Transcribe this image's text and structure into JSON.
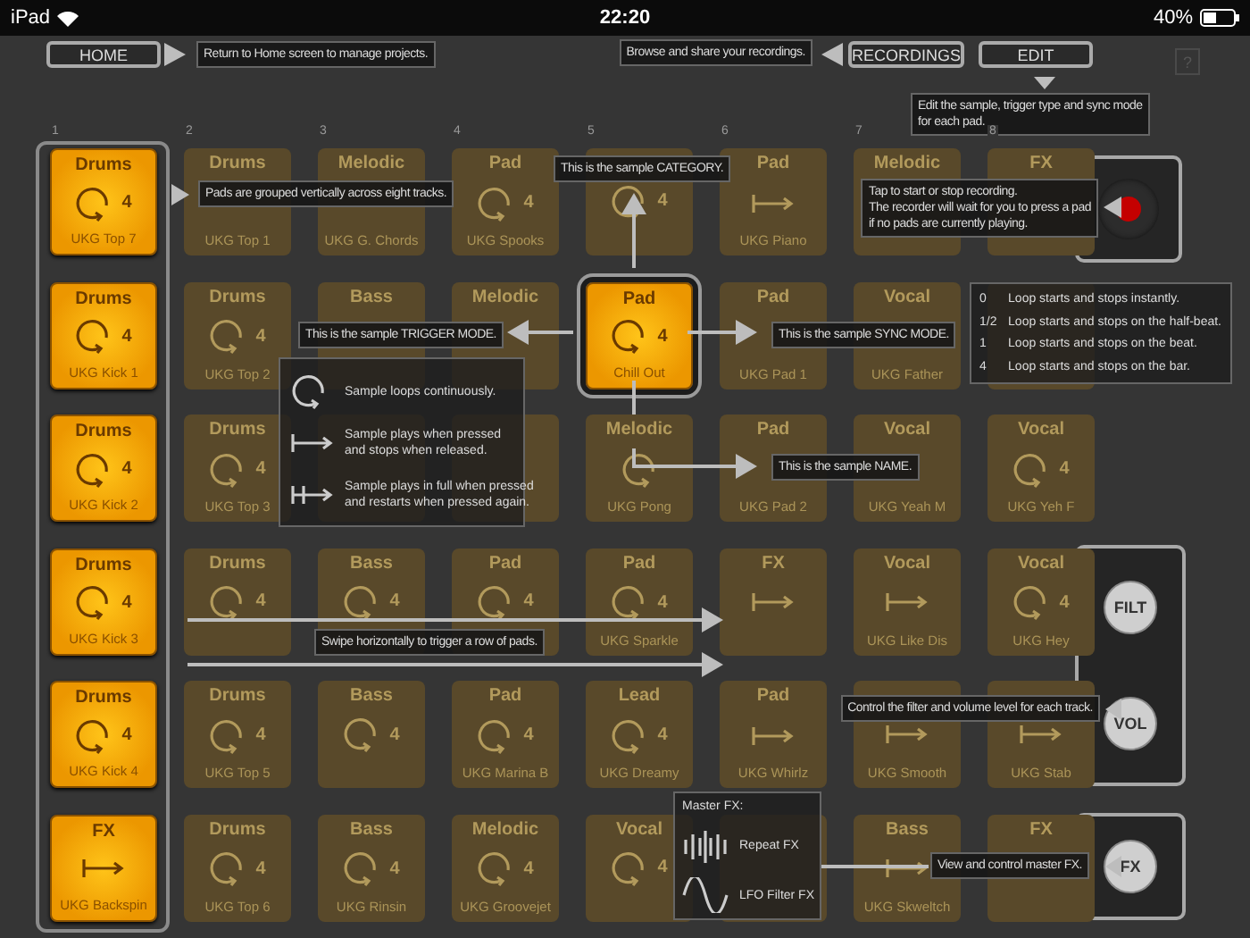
{
  "status_bar": {
    "carrier": "iPad",
    "time": "22:20",
    "battery": "40%"
  },
  "toolbar": {
    "home": "HOME",
    "recordings": "RECORDINGS",
    "edit": "EDIT",
    "help": "?"
  },
  "column_numbers": [
    "1",
    "2",
    "3",
    "4",
    "5",
    "6",
    "7",
    "8"
  ],
  "pad_rows": [
    {
      "pads": [
        {
          "category": "Drums",
          "trigger": {
            "kind": "loop"
          },
          "sync": "4",
          "name": "UKG Top 7",
          "lit": true,
          "selected": false
        },
        {
          "category": "Drums",
          "name": "UKG Top 1",
          "lit": false,
          "selected": false
        },
        {
          "category": "Melodic",
          "name": "UKG G. Chords",
          "lit": false,
          "selected": false
        },
        {
          "category": "Pad",
          "trigger": {
            "kind": "loop"
          },
          "sync": "4",
          "name": "UKG Spooks",
          "lit": false,
          "selected": false
        },
        {
          "trigger": {
            "kind": "loop"
          },
          "sync": "4",
          "lit": false,
          "selected": false
        },
        {
          "category": "Pad",
          "trigger": {
            "kind": "hold"
          },
          "name": "UKG Piano",
          "lit": false,
          "selected": false
        },
        {
          "category": "Melodic",
          "lit": false,
          "selected": false
        },
        {
          "category": "FX",
          "lit": false,
          "selected": false
        }
      ]
    },
    {
      "pads": [
        {
          "category": "Drums",
          "trigger": {
            "kind": "loop"
          },
          "sync": "4",
          "name": "UKG Kick 1",
          "lit": true,
          "selected": false
        },
        {
          "category": "Drums",
          "trigger": {
            "kind": "loop"
          },
          "sync": "4",
          "name": "UKG Top 2",
          "lit": false,
          "selected": false
        },
        {
          "category": "Bass",
          "lit": false,
          "selected": false
        },
        {
          "category": "Melodic",
          "lit": false,
          "selected": false
        },
        {
          "category": "Pad",
          "trigger": {
            "kind": "loop"
          },
          "sync": "4",
          "name": "Chill Out",
          "lit": true,
          "selected": true
        },
        {
          "category": "Pad",
          "name": "UKG Pad 1",
          "lit": false,
          "selected": false
        },
        {
          "category": "Vocal",
          "name": "UKG Father",
          "lit": false,
          "selected": false
        },
        {
          "lit": false,
          "selected": false
        }
      ]
    },
    {
      "pads": [
        {
          "category": "Drums",
          "trigger": {
            "kind": "loop"
          },
          "sync": "4",
          "name": "UKG Kick 2",
          "lit": true,
          "selected": false
        },
        {
          "category": "Drums",
          "trigger": {
            "kind": "loop"
          },
          "sync": "4",
          "name": "UKG Top 3",
          "lit": false,
          "selected": false
        },
        {
          "lit": false
        },
        {
          "lit": false,
          "selected": false
        },
        {
          "category": "Melodic",
          "trigger": {
            "kind": "loop"
          },
          "name": "UKG Pong",
          "lit": false,
          "selected": false
        },
        {
          "category": "Pad",
          "name": "UKG Pad 2",
          "lit": false,
          "selected": false
        },
        {
          "category": "Vocal",
          "name": "UKG Yeah M",
          "lit": false,
          "selected": false
        },
        {
          "category": "Vocal",
          "trigger": {
            "kind": "loop"
          },
          "sync": "4",
          "name": "UKG Yeh F",
          "lit": false,
          "selected": false
        }
      ]
    },
    {
      "pads": [
        {
          "category": "Drums",
          "trigger": {
            "kind": "loop"
          },
          "sync": "4",
          "name": "UKG Kick 3",
          "lit": true,
          "selected": false
        },
        {
          "category": "Drums",
          "trigger": {
            "kind": "loop"
          },
          "sync": "4",
          "lit": false,
          "selected": false
        },
        {
          "category": "Bass",
          "trigger": {
            "kind": "loop"
          },
          "sync": "4",
          "lit": false,
          "selected": false
        },
        {
          "category": "Pad",
          "trigger": {
            "kind": "loop"
          },
          "sync": "4",
          "lit": false,
          "selected": false
        },
        {
          "category": "Pad",
          "trigger": {
            "kind": "loop"
          },
          "sync": "4",
          "name": "UKG Sparkle",
          "lit": false,
          "selected": false
        },
        {
          "category": "FX",
          "trigger": {
            "kind": "hold"
          },
          "lit": false,
          "selected": false
        },
        {
          "category": "Vocal",
          "trigger": {
            "kind": "hold"
          },
          "name": "UKG Like Dis",
          "lit": false,
          "selected": false
        },
        {
          "category": "Vocal",
          "trigger": {
            "kind": "loop"
          },
          "sync": "4",
          "name": "UKG Hey",
          "lit": false,
          "selected": false
        }
      ]
    },
    {
      "pads": [
        {
          "category": "Drums",
          "trigger": {
            "kind": "loop"
          },
          "sync": "4",
          "name": "UKG Kick 4",
          "lit": true,
          "selected": false
        },
        {
          "category": "Drums",
          "trigger": {
            "kind": "loop"
          },
          "sync": "4",
          "name": "UKG Top 5",
          "lit": false,
          "selected": false
        },
        {
          "category": "Bass",
          "trigger": {
            "kind": "loop"
          },
          "sync": "4",
          "lit": false,
          "selected": false
        },
        {
          "category": "Pad",
          "trigger": {
            "kind": "loop"
          },
          "sync": "4",
          "name": "UKG Marina B",
          "lit": false,
          "selected": false
        },
        {
          "category": "Lead",
          "trigger": {
            "kind": "loop"
          },
          "sync": "4",
          "name": "UKG Dreamy",
          "lit": false,
          "selected": false
        },
        {
          "category": "Pad",
          "trigger": {
            "kind": "hold"
          },
          "name": "UKG Whirlz",
          "lit": false,
          "selected": false
        },
        {
          "trigger": {
            "kind": "hold"
          },
          "name": "UKG Smooth",
          "lit": false,
          "selected": false
        },
        {
          "trigger": {
            "kind": "hold"
          },
          "name": "UKG Stab",
          "lit": false,
          "selected": false
        }
      ]
    },
    {
      "pads": [
        {
          "category": "FX",
          "trigger": {
            "kind": "hold"
          },
          "name": "UKG Backspin",
          "lit": true,
          "selected": false
        },
        {
          "category": "Drums",
          "trigger": {
            "kind": "loop"
          },
          "sync": "4",
          "name": "UKG Top 6",
          "lit": false,
          "selected": false
        },
        {
          "category": "Bass",
          "trigger": {
            "kind": "loop"
          },
          "sync": "4",
          "name": "UKG Rinsin",
          "lit": false,
          "selected": false
        },
        {
          "category": "Melodic",
          "trigger": {
            "kind": "loop"
          },
          "sync": "4",
          "name": "UKG Groovejet",
          "lit": false,
          "selected": false
        },
        {
          "category": "Vocal",
          "trigger": {
            "kind": "loop"
          },
          "sync": "4",
          "lit": false,
          "selected": false
        },
        {
          "lit": false,
          "selected": false
        },
        {
          "category": "Bass",
          "trigger": {
            "kind": "hold"
          },
          "name": "UKG Skweltch",
          "lit": false,
          "selected": false
        },
        {
          "category": "FX",
          "lit": false,
          "selected": false
        }
      ]
    }
  ],
  "track_controls": {
    "filter": "FILT",
    "volume": "VOL",
    "fx": "FX"
  },
  "help": {
    "home": "Return to Home screen to manage projects.",
    "recordings": "Browse and share your recordings.",
    "edit": "Edit the sample, trigger type and sync mode\nfor each pad.",
    "tracks": "Pads are grouped vertically across eight tracks.",
    "category": "This is the sample CATEGORY.",
    "trigger_mode": "This is the sample TRIGGER MODE.",
    "sync_mode": "This is the sample SYNC MODE.",
    "name": "This is the sample NAME.",
    "record": "Tap to start or stop recording.\nThe recorder will wait for you to press a pad\nif no pads are currently playing.",
    "swipe": "Swipe horizontally to trigger a row of pads.",
    "track_controls": "Control the filter and volume level for each track.",
    "master_fx": "View and control master FX."
  },
  "trigger_legend": [
    {
      "kind": "loop",
      "text": "Sample loops continuously."
    },
    {
      "kind": "hold",
      "text": "Sample plays when pressed\nand stops when released."
    },
    {
      "kind": "full",
      "text": "Sample plays in full when pressed\nand restarts when pressed again."
    }
  ],
  "sync_legend": [
    {
      "value": "0",
      "text": "Loop starts and stops instantly."
    },
    {
      "value": "1/2",
      "text": "Loop starts and stops on the half-beat."
    },
    {
      "value": "1",
      "text": "Loop starts and stops on the beat."
    },
    {
      "value": "4",
      "text": "Loop starts and stops on the bar."
    }
  ],
  "master_fx_legend": {
    "title": "Master FX:",
    "items": [
      {
        "kind": "repeat",
        "text": "Repeat FX"
      },
      {
        "kind": "lfo",
        "text": "LFO Filter FX"
      }
    ]
  }
}
